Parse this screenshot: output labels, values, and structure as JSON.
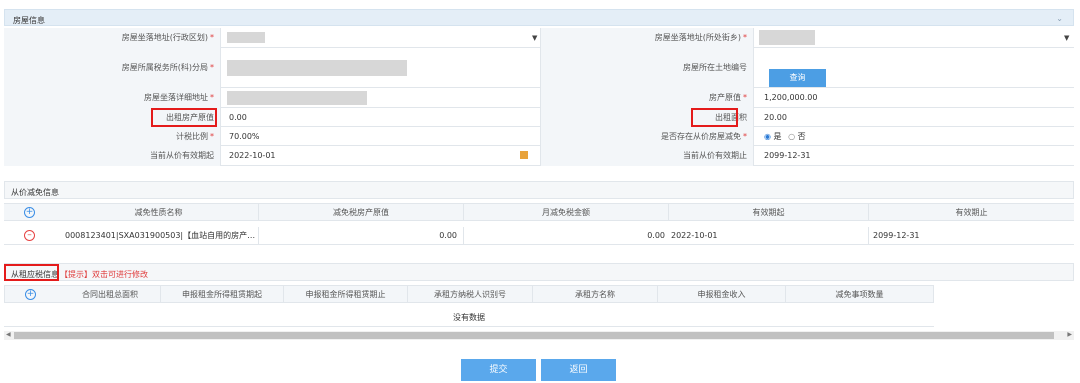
{
  "house_info": {
    "title": "房屋信息",
    "labels": {
      "location_district": "房屋坐落地址(行政区划)",
      "location_street": "房屋坐落地址(所处街乡)",
      "tax_office": "房屋所属税务所(科)分局",
      "land_number": "房屋所在土地编号",
      "detail_address": "房屋坐落详细地址",
      "original_value": "房产原值",
      "rental_original_value": "出租房产原值",
      "rental_area": "出租面积",
      "tax_ratio": "计税比例",
      "value_based_reduction": "是否存在从价房屋减免",
      "valid_from": "当前从价有效期起",
      "valid_to": "当前从价有效期止"
    },
    "required_mark": "*",
    "values": {
      "original_value": "1,200,000.00",
      "rental_original_value": "0.00",
      "rental_area": "20.00",
      "tax_ratio": "70.00%",
      "valid_from": "2022-10-01",
      "valid_to": "2099-12-31"
    },
    "radio": {
      "yes": "是",
      "no": "否",
      "selected": "yes"
    },
    "query_button": "查询"
  },
  "reduction_info": {
    "title": "从价减免信息",
    "columns": [
      "减免性质名称",
      "减免税房产原值",
      "月减免税金额",
      "有效期起",
      "有效期止"
    ],
    "rows": [
      {
        "name": "0008123401|SXA031900503|【血站自用的房产…",
        "original": "0.00",
        "monthly": "0.00",
        "from": "2022-10-01",
        "to": "2099-12-31"
      }
    ]
  },
  "rental_info": {
    "title": "从租应税信息",
    "hint": "【提示】双击可进行修改",
    "columns": [
      "合同出租总面积",
      "申报租金所得租赁期起",
      "申报租金所得租赁期止",
      "承租方纳税人识别号",
      "承租方名称",
      "申报租金收入",
      "减免事项数量"
    ],
    "empty_text": "没有数据"
  },
  "buttons": {
    "submit": "提交",
    "back": "返回"
  },
  "colors": {
    "accent": "#4c9ee4",
    "highlight": "#e41b1b",
    "header_bg": "#e4eef7"
  }
}
